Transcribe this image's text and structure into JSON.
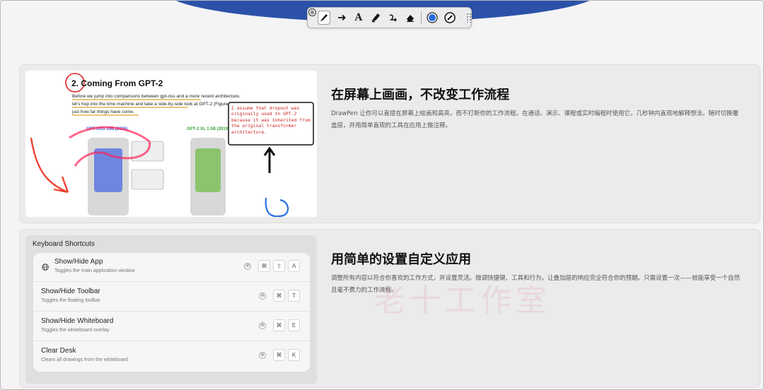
{
  "toolbar": {
    "close": "⊗",
    "tools": [
      {
        "name": "pen",
        "icon": "pen-icon"
      },
      {
        "name": "arrow",
        "icon": "arrow-icon"
      },
      {
        "name": "text",
        "icon": "text-icon",
        "label": "A"
      },
      {
        "name": "highlighter",
        "icon": "highlighter-icon"
      },
      {
        "name": "curve",
        "icon": "curve-icon"
      },
      {
        "name": "eraser",
        "icon": "eraser-icon"
      },
      {
        "name": "color",
        "icon": "color-dot-icon",
        "color": "#2b6fde"
      },
      {
        "name": "stroke",
        "icon": "stroke-width-icon"
      }
    ]
  },
  "colors": {
    "brand": "#2b52a8",
    "accent": "#2b6fde",
    "card": "#ebebec"
  },
  "feature1": {
    "title": "在屏幕上画画，不改变工作流程",
    "desc": "DrawPen 让你可以直接在屏幕上绘画和高亮，而不打断你的工作流程。在通话、演示、课程或实时编程时使用它，几秒钟内直观地解释想法。随时切换覆盖层，并用简单直观的工具在应用上做注释。"
  },
  "feature2": {
    "title": "用简单的设置自定义应用",
    "desc": "调整所有内容以符合你喜欢的工作方式，并设置灵活。微调快捷键、工具和行为，让叠加层的响应完全符合你的预期。只需设置一次——就能享受一个自然且毫不费力的工作流程。"
  },
  "preview": {
    "heading": "2. Coming From GPT-2",
    "lines": [
      "Before we jump into comparisons between gpt-oss and a more recent architecture,",
      "let's hop into the time machine and take a side-by-side look at GPT-2 (Figure 2) to see",
      "just how far things have come."
    ],
    "left_label": "GPT-OSS 20B (2025)",
    "right_label": "GPT-2 XL 1.5B (2019)",
    "note": "I assume that dropout was originally used in GPT-2 because it was inherited from the original transformer architecture."
  },
  "shortcuts": {
    "title": "Keyboard Shortcuts",
    "items": [
      {
        "name": "Show/Hide App",
        "desc": "Toggles the main application window",
        "keys": [
          "⌘",
          "⇧",
          "A"
        ],
        "icon": "globe-icon"
      },
      {
        "name": "Show/Hide Toolbar",
        "desc": "Toggles the floating toolbar",
        "keys": [
          "⌘",
          "T"
        ]
      },
      {
        "name": "Show/Hide Whiteboard",
        "desc": "Toggles the whiteboard overlay",
        "keys": [
          "⌘",
          "E"
        ]
      },
      {
        "name": "Clear Desk",
        "desc": "Clears all drawings from the whiteboard",
        "keys": [
          "⌘",
          "K"
        ]
      }
    ],
    "clear_glyph": "⊗"
  },
  "watermark": "老十工作室"
}
